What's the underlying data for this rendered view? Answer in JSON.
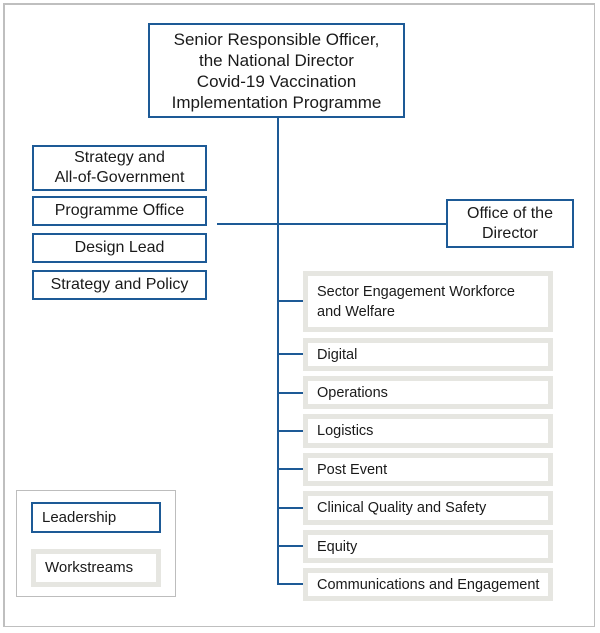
{
  "diagram": {
    "top": {
      "label": "Senior Responsible Officer, the National Director Covid-19 Vaccination Implementation Programme",
      "lines": [
        "Senior Responsible Officer,",
        "the National Director",
        "Covid-19 Vaccination",
        "Implementation Programme"
      ]
    },
    "left_units": [
      {
        "lines": [
          "Strategy and",
          "All-of-Government"
        ]
      },
      {
        "lines": [
          "Programme Office"
        ]
      },
      {
        "lines": [
          "Design Lead"
        ]
      },
      {
        "lines": [
          "Strategy and Policy"
        ]
      }
    ],
    "right_unit": {
      "lines": [
        "Office of the",
        "Director"
      ]
    },
    "workstreams": [
      {
        "lines": [
          "Sector Engagement Workforce",
          "and Welfare"
        ]
      },
      {
        "lines": [
          "Digital"
        ]
      },
      {
        "lines": [
          "Operations"
        ]
      },
      {
        "lines": [
          "Logistics"
        ]
      },
      {
        "lines": [
          "Post Event"
        ]
      },
      {
        "lines": [
          "Clinical Quality and Safety"
        ]
      },
      {
        "lines": [
          "Equity"
        ]
      },
      {
        "lines": [
          "Communications and Engagement"
        ]
      }
    ],
    "legend": {
      "leadership": "Leadership",
      "workstreams": "Workstreams"
    },
    "colors": {
      "leadership_border": "#1d5a96",
      "workstream_border": "#e6e6e1",
      "connector": "#1d5a96"
    }
  }
}
